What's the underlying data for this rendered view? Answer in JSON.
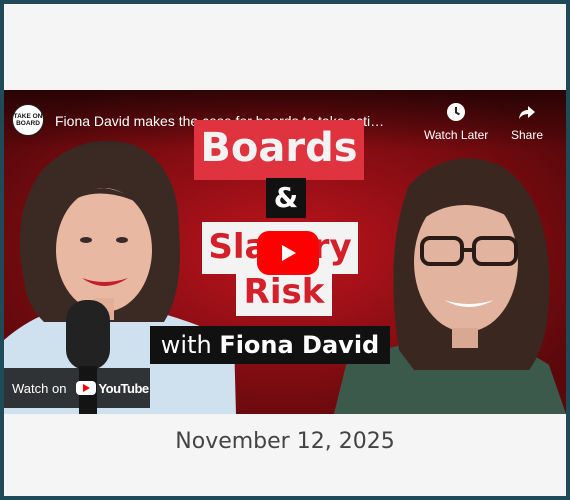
{
  "date": "November 12, 2025",
  "video": {
    "channel_logo_text": "TAKE ON BOARD",
    "title": "Fiona David makes the case for boards to take acti…",
    "controls": {
      "watch_later_label": "Watch Later",
      "share_label": "Share"
    },
    "thumbnail_text": {
      "boards": "Boards",
      "ampersand": "&",
      "slavery": "Slavery",
      "risk": "Risk",
      "with": "with",
      "name": "Fiona David"
    },
    "watch_on": {
      "label": "Watch on",
      "brand": "YouTube"
    }
  },
  "colors": {
    "frame": "#1f4a58",
    "card": "#f5f5f5",
    "accent_red": "#e03340",
    "play_red": "#ff0000"
  }
}
